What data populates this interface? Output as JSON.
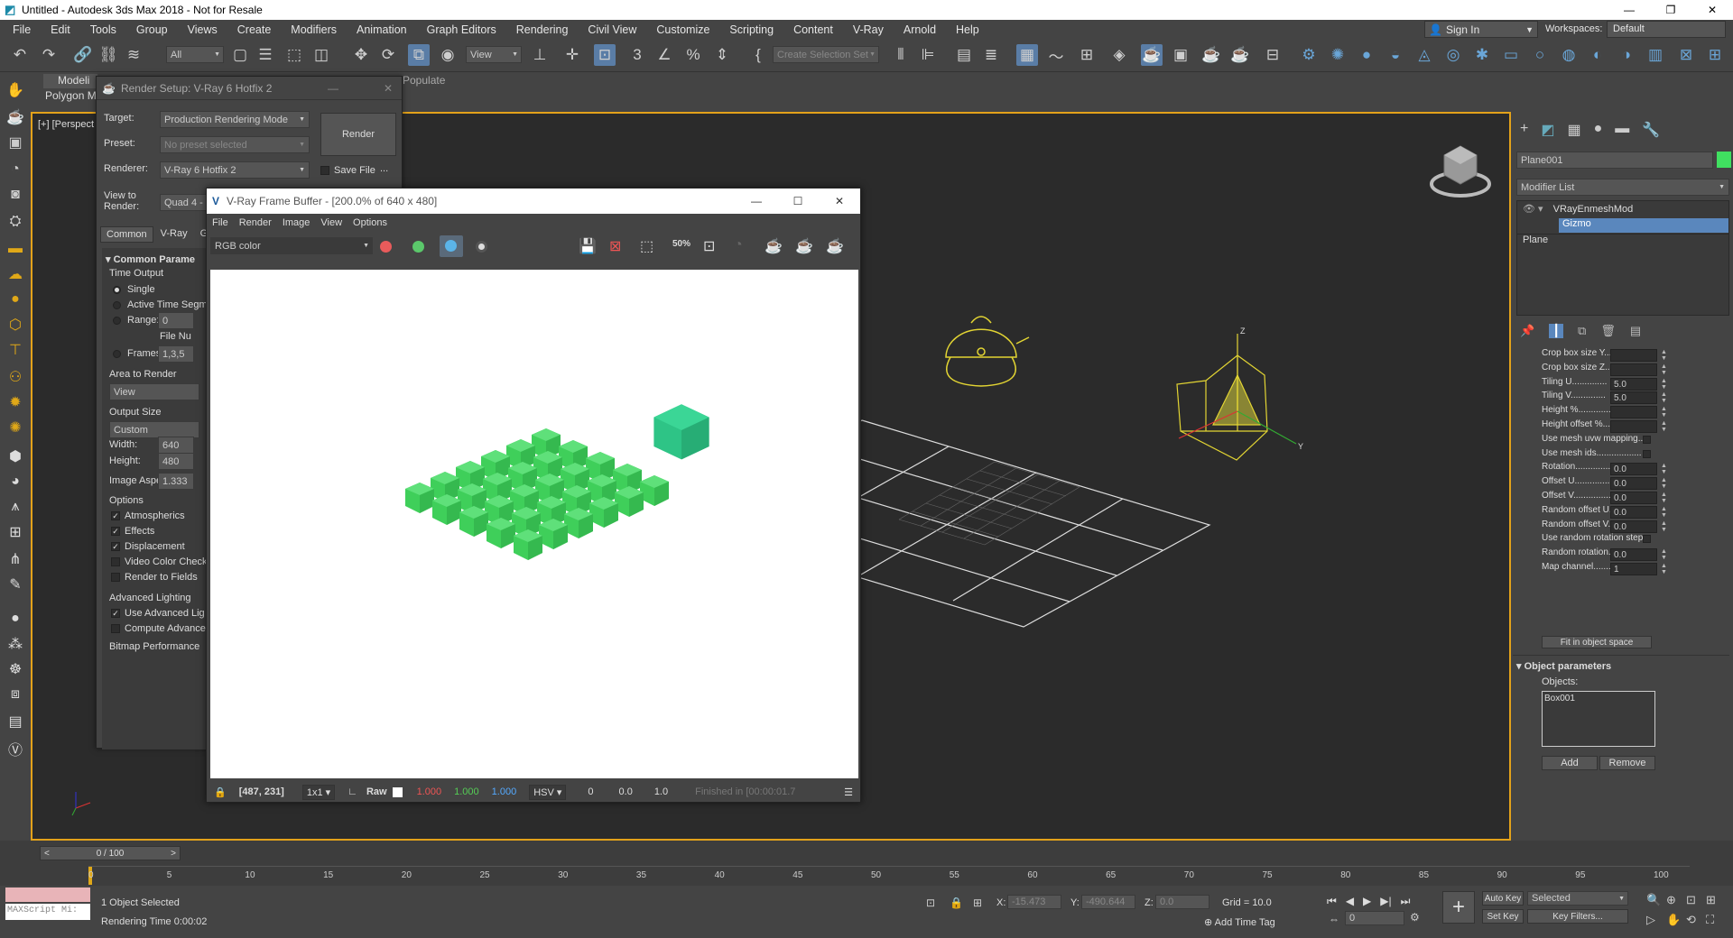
{
  "window": {
    "title": "Untitled - Autodesk 3ds Max 2018 - Not for Resale",
    "min": "—",
    "max": "❐",
    "close": "✕"
  },
  "menu": [
    "File",
    "Edit",
    "Tools",
    "Group",
    "Views",
    "Create",
    "Modifiers",
    "Animation",
    "Graph Editors",
    "Rendering",
    "Civil View",
    "Customize",
    "Scripting",
    "Content",
    "V-Ray",
    "Arnold",
    "Help"
  ],
  "signin": "Sign In",
  "workspaces_label": "Workspaces:",
  "workspaces_value": "Default",
  "toolbar": {
    "filter": "All",
    "view": "View",
    "selection_set": "Create Selection Set"
  },
  "ribbon": {
    "tab1": "Modeli",
    "tab2": "Polygon M",
    "populate": "Populate"
  },
  "viewport": {
    "label": "[+] [Perspect"
  },
  "render_setup": {
    "title": "Render Setup: V-Ray 6 Hotfix 2",
    "target_label": "Target:",
    "target": "Production Rendering Mode",
    "preset_label": "Preset:",
    "preset": "No preset selected",
    "renderer_label": "Renderer:",
    "renderer": "V-Ray 6 Hotfix 2",
    "save_file": "Save File",
    "ellipsis": "...",
    "render_btn": "Render",
    "view_to_render": "View to Render:",
    "view_value": "Quad 4 -",
    "tabs": [
      "Common",
      "V-Ray",
      "G"
    ],
    "section": "Common Parame",
    "time_output": "Time Output",
    "single": "Single",
    "active": "Active Time Segm",
    "range": "Range:",
    "range_val": "0",
    "file_num": "File Nu",
    "frames": "Frames",
    "frames_val": "1,3,5",
    "area": "Area to Render",
    "area_val": "View",
    "output_size": "Output Size",
    "output_val": "Custom",
    "width_label": "Width:",
    "width": "640",
    "height_label": "Height:",
    "height": "480",
    "aspect_label": "Image Aspect:",
    "aspect": "1.333",
    "options": "Options",
    "atmo": "Atmospherics",
    "effects": "Effects",
    "displacement": "Displacement",
    "videocheck": "Video Color Check",
    "fields": "Render to Fields",
    "adv": "Advanced Lighting",
    "useadv": "Use Advanced Lig",
    "compute": "Compute Advance",
    "bitmap": "Bitmap Performance"
  },
  "vfb": {
    "title": "V-Ray Frame Buffer - [200.0% of 640 x 480]",
    "menu": [
      "File",
      "Render",
      "Image",
      "View",
      "Options"
    ],
    "channel": "RGB color",
    "coords": "[487, 231]",
    "ratio": "1x1",
    "raw": "Raw",
    "r": "1.000",
    "g": "1.000",
    "b": "1.000",
    "mode": "HSV",
    "h": "0",
    "s": "0.0",
    "v": "1.0",
    "status": "Finished in [00:00:01.7"
  },
  "cmd": {
    "object_name": "Plane001",
    "modifier_list": "Modifier List",
    "stack": [
      "VRayEnmeshMod",
      "Gizmo",
      "Plane"
    ],
    "params": [
      {
        "label": "Crop box size Y.....",
        "val": ""
      },
      {
        "label": "Crop box size Z.....",
        "val": ""
      },
      {
        "label": "Tiling U..............",
        "val": "5.0"
      },
      {
        "label": "Tiling V..............",
        "val": "5.0"
      },
      {
        "label": "Height %..............",
        "val": ""
      },
      {
        "label": "Height offset %.....",
        "val": ""
      },
      {
        "label": "Use mesh uvw mapping.....",
        "val": ""
      },
      {
        "label": "Use mesh ids..................",
        "val": ""
      },
      {
        "label": "Rotation.................",
        "val": "0.0"
      },
      {
        "label": "Offset U.................",
        "val": "0.0"
      },
      {
        "label": "Offset V.................",
        "val": "0.0"
      },
      {
        "label": "Random offset U.....",
        "val": "0.0"
      },
      {
        "label": "Random offset V.....",
        "val": "0.0"
      },
      {
        "label": "Use random rotation steps.",
        "val": ""
      },
      {
        "label": "Random rotation.....",
        "val": "0.0"
      },
      {
        "label": "Map channel..........",
        "val": "1"
      }
    ],
    "fit": "Fit in object space",
    "obj_params": "Object parameters",
    "objects": "Objects:",
    "obj_item": "Box001",
    "add": "Add",
    "remove": "Remove"
  },
  "timeline": {
    "slider": "0 / 100",
    "ticks": [
      "0",
      "5",
      "10",
      "15",
      "20",
      "25",
      "30",
      "35",
      "40",
      "45",
      "50",
      "55",
      "60",
      "65",
      "70",
      "75",
      "80",
      "85",
      "90",
      "95",
      "100"
    ]
  },
  "status": {
    "maxscript": "MAXScript Mi:",
    "selected": "1 Object Selected",
    "render_time": "Rendering Time 0:00:02",
    "x_label": "X:",
    "x": "-15.473",
    "y_label": "Y:",
    "y": "-490.644",
    "z_label": "Z:",
    "z": "0.0",
    "grid": "Grid = 10.0",
    "add_time_tag": "Add Time Tag",
    "auto_key": "Auto Key",
    "selected_mode": "Selected",
    "set_key": "Set Key",
    "key_filters": "Key Filters...",
    "frame": "0"
  }
}
